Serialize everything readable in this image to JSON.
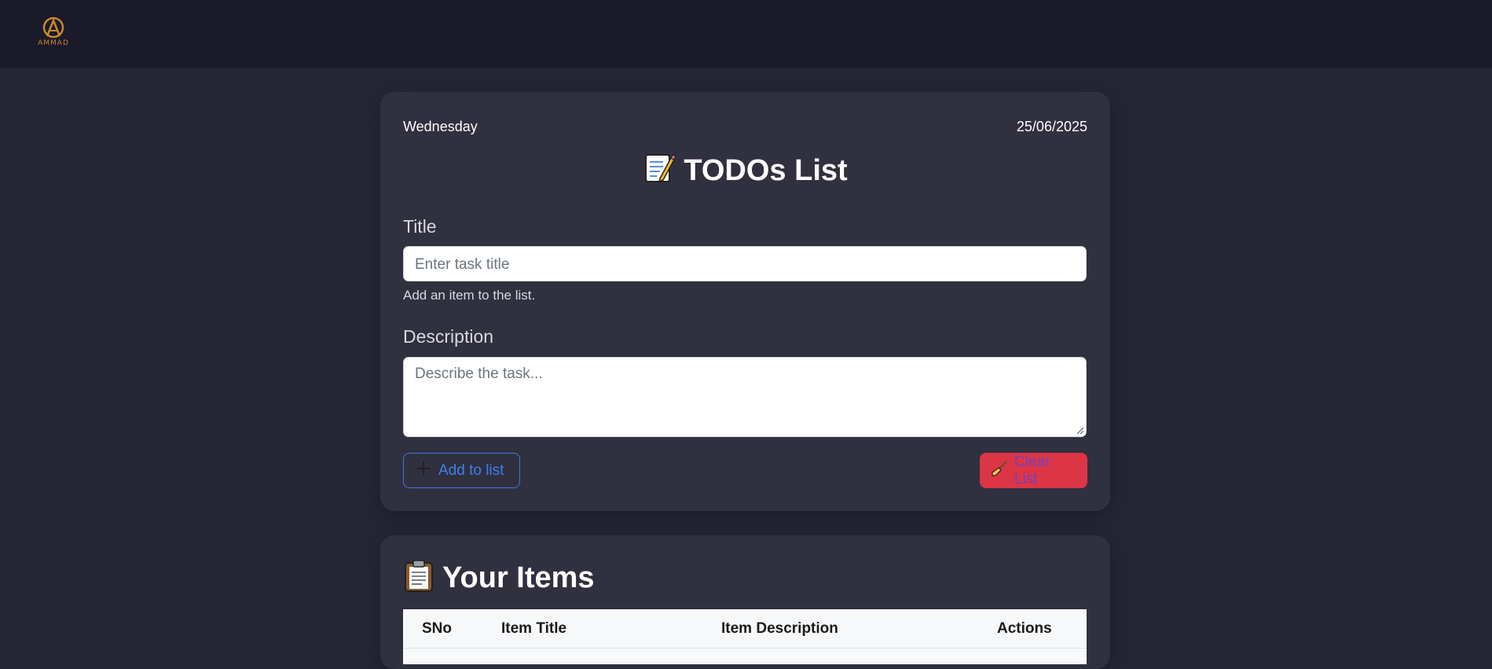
{
  "brand": {
    "logo_text": "AMMAD",
    "accent": "#c9892a"
  },
  "form": {
    "day": "Wednesday",
    "date": "25/06/2025",
    "heading": "TODOs List",
    "heading_icon": "memo-icon",
    "title_label": "Title",
    "title_placeholder": "Enter task title",
    "title_help": "Add an item to the list.",
    "description_label": "Description",
    "description_placeholder": "Describe the task...",
    "add_button": "Add to list",
    "clear_button": "Clear List"
  },
  "items": {
    "heading": "Your Items",
    "heading_icon": "clipboard-icon",
    "columns": [
      "SNo",
      "Item Title",
      "Item Description",
      "Actions"
    ]
  },
  "colors": {
    "background": "#252536",
    "navbar": "#1b1a2b",
    "card": "#30303f",
    "primary": "#3d7ff0",
    "danger": "#dc3546"
  }
}
